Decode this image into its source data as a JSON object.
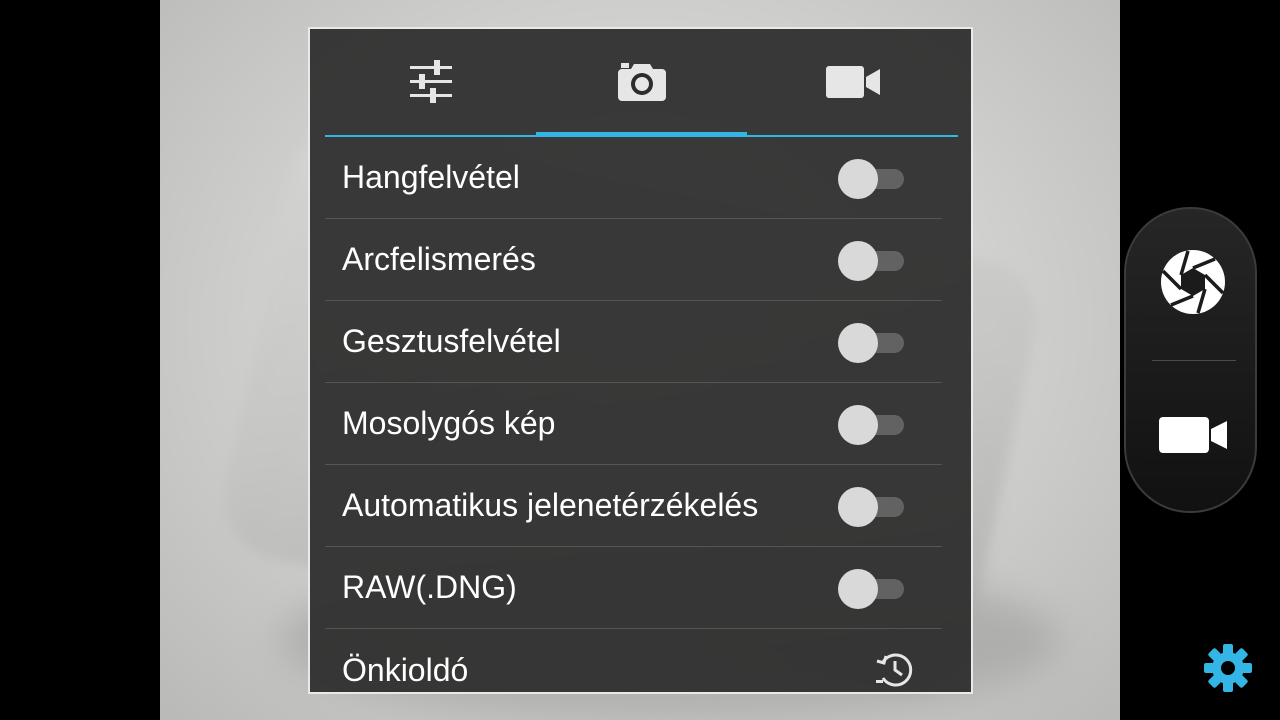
{
  "settings": {
    "tabs": [
      {
        "icon": "sliders-icon",
        "active": false
      },
      {
        "icon": "camera-icon",
        "active": true
      },
      {
        "icon": "video-camera-icon",
        "active": false
      }
    ],
    "rows": [
      {
        "label": "Hangfelvétel",
        "control": "toggle",
        "on": false
      },
      {
        "label": "Arcfelismerés",
        "control": "toggle",
        "on": false
      },
      {
        "label": "Gesztusfelvétel",
        "control": "toggle",
        "on": false
      },
      {
        "label": "Mosolygós kép",
        "control": "toggle",
        "on": false
      },
      {
        "label": "Automatikus jelenetérzékelés",
        "control": "toggle",
        "on": false
      },
      {
        "label": "RAW(.DNG)",
        "control": "toggle",
        "on": false
      },
      {
        "label": "Önkioldó",
        "control": "timer-icon"
      }
    ]
  },
  "mode_switcher": {
    "items": [
      {
        "icon": "shutter-aperture-icon"
      },
      {
        "icon": "video-camera-icon"
      }
    ]
  },
  "settings_button": {
    "icon": "gear-icon"
  },
  "colors": {
    "accent": "#33b5e5",
    "panel": "#2c2c2c",
    "text": "#ffffff",
    "toggle_off_thumb": "#d9d9d9",
    "toggle_off_track": "#626262"
  }
}
